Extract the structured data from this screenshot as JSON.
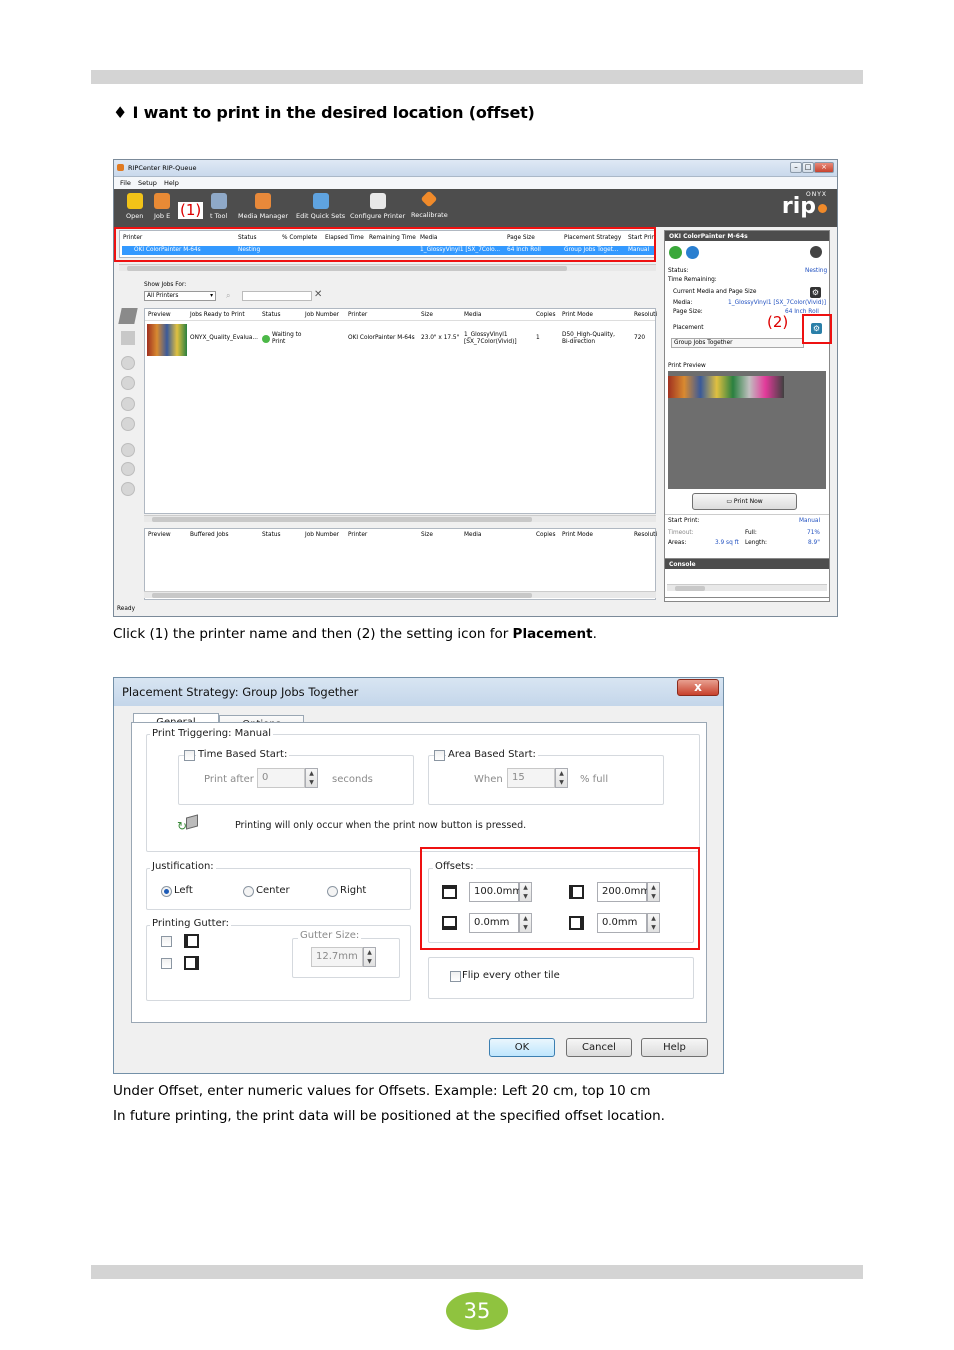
{
  "heading": "♦  I want to print in the desired location (offset)",
  "caption1_pre": "Click (1) the printer name and then (2) the setting icon for ",
  "caption1_bold": "Placement",
  "caption1_post": ".",
  "caption2_line1": "Under Offset, enter numeric values for Offsets. Example: Left 20 cm, top 10 cm",
  "caption2_line2": "In future printing, the print data will be positioned at the specified offset location.",
  "page_number": "35",
  "colors": {
    "accent_green": "#8fc33f",
    "highlight_red": "#e11111",
    "toolbar_dark": "#4d4d4d",
    "selection_blue": "#3399ff"
  },
  "rip": {
    "window_title": "RIPCenter RIP-Queue",
    "menu": [
      "File",
      "Setup",
      "Help"
    ],
    "toolbar": [
      "Open",
      "Job E",
      "t Tool",
      "Media Manager",
      "Edit Quick Sets",
      "Configure Printer",
      "Recalibrate"
    ],
    "brand_small": "ONYX",
    "brand_big": "rip",
    "callout1": "(1)",
    "callout2": "(2)",
    "printer_cols": [
      "Printer",
      "Status",
      "% Complete",
      "Elapsed Time",
      "Remaining Time",
      "Media",
      "Page Size",
      "Placement Strategy",
      "Start Prin"
    ],
    "printer_row": [
      "OKI ColorPainter M-64s",
      "Nesting",
      "",
      "",
      "",
      "1_GlossyVinyl1 [SX_7Colo...",
      "64 Inch Roll",
      "Group Jobs Toget...",
      "Manual"
    ],
    "show_jobs_label": "Show Jobs For:",
    "show_jobs_value": "All Printers",
    "ready_cols": [
      "Preview",
      "Jobs Ready to Print",
      "Status",
      "Job Number",
      "Printer",
      "Size",
      "Media",
      "Copies",
      "Print Mode",
      "Resoluti"
    ],
    "ready_row": {
      "name": "ONYX_Quality_Evalua...",
      "status_line1": "Waiting to",
      "status_line2": "Print",
      "printer": "OKI ColorPainter M-64s",
      "size": "23.0\" x 17.5\"",
      "media_line1": "1_GlossyVinyl1",
      "media_line2": "[SX_7Color(Vivid)]",
      "copies": "1",
      "mode_line1": "D50_High-Quality,",
      "mode_line2": "Bi-direction",
      "resolution": "720"
    },
    "buffer_cols": [
      "Preview",
      "Buffered Jobs",
      "Status",
      "Job Number",
      "Printer",
      "Size",
      "Media",
      "Copies",
      "Print Mode",
      "Resoluti"
    ],
    "status_bar": "Ready",
    "panel": {
      "title": "OKI ColorPainter M-64s",
      "status_label": "Status:",
      "status_value": "Nesting",
      "time_remaining": "Time Remaining:",
      "current_media": "Current Media and Page Size",
      "media_label": "Media:",
      "media_value": "1_GlossyVinyl1 [SX_7Color(Vivid)]",
      "page_size_label": "Page Size:",
      "page_size_value": "64 Inch Roll",
      "placement_label": "Placement",
      "placement_value": "Group Jobs Together",
      "print_preview": "Print Preview",
      "print_now": "Print Now",
      "start_print_label": "Start Print:",
      "start_print_value": "Manual",
      "timeout_label": "Timeout:",
      "full_label": "Full:",
      "full_value": "71%",
      "areas_label": "Areas:",
      "areas_value": "3.9 sq ft",
      "length_label": "Length:",
      "length_value": "8.9\"",
      "console": "Console"
    }
  },
  "dialog": {
    "title": "Placement Strategy: Group Jobs Together",
    "close": "x",
    "tabs": [
      "General",
      "Options"
    ],
    "print_triggering": "Print Triggering: Manual",
    "time_based": "Time Based Start:",
    "print_after": "Print after",
    "print_after_value": "0",
    "seconds": "seconds",
    "area_based": "Area Based Start:",
    "when": "When",
    "when_value": "15",
    "percent_full": "% full",
    "printing_note": "Printing will only occur when the print now button is pressed.",
    "justification": "Justification:",
    "justify_options": [
      "Left",
      "Center",
      "Right"
    ],
    "offsets": "Offsets:",
    "offset_top": "100.0mm",
    "offset_left": "200.0mm",
    "offset_bottom": "0.0mm",
    "offset_right": "0.0mm",
    "printing_gutter": "Printing Gutter:",
    "gutter_size": "Gutter Size:",
    "gutter_value": "12.7mm",
    "flip_tile": "Flip every other tile",
    "ok": "OK",
    "cancel": "Cancel",
    "help": "Help"
  }
}
